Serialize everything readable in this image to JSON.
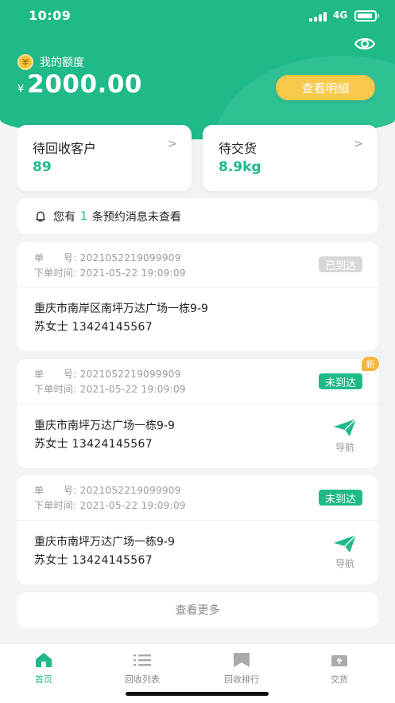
{
  "status_bar": {
    "time": "10:09",
    "network": "4G"
  },
  "header": {
    "quota_label": "我的额度",
    "coin_symbol": "¥",
    "currency": "¥",
    "amount": "2000.00",
    "detail_button": "查看明细"
  },
  "stats": [
    {
      "title": "待回收客户",
      "value": "89",
      "arrow": ">"
    },
    {
      "title": "待交货",
      "value": "8.9kg",
      "arrow": ">"
    }
  ],
  "notice": {
    "prefix": "您有",
    "count": "1",
    "suffix": "条预约消息未查看"
  },
  "order_labels": {
    "number": "单　　号:",
    "time": "下单时间:"
  },
  "orders": [
    {
      "number": "2021052219099909",
      "time": "2021-05-22 19:09:09",
      "status": "已到达",
      "address": "重庆市南岸区南坪万达广场一栋9-9",
      "person": "苏女士  13424145567"
    },
    {
      "number": "2021052219099909",
      "time": "2021-05-22 19:09:09",
      "status": "未到达",
      "new_tag": "新",
      "address": "重庆市南坪万达广场一栋9-9",
      "person": "苏女士  13424145567",
      "nav_label": "导航"
    },
    {
      "number": "2021052219099909",
      "time": "2021-05-22 19:09:09",
      "status": "未到达",
      "address": "重庆市南坪万达广场一栋9-9",
      "person": "苏女士  13424145567",
      "nav_label": "导航"
    }
  ],
  "more_button": "查看更多",
  "tabs": [
    {
      "label": "首页",
      "icon": "home-icon",
      "active": true
    },
    {
      "label": "回收列表",
      "icon": "list-icon"
    },
    {
      "label": "回收排行",
      "icon": "bookmark-icon"
    },
    {
      "label": "交货",
      "icon": "delivery-box-icon"
    }
  ],
  "colors": {
    "primary": "#1fb98a",
    "accent": "#f7c84a",
    "arrived": "#d8d8d8",
    "background": "#f2f3f5"
  }
}
